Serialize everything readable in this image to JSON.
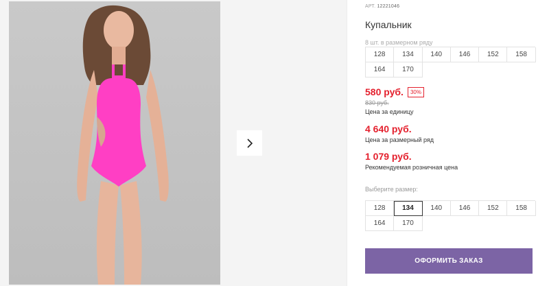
{
  "gallery": {
    "image_alt": "photo",
    "next_icon": "chevron-right-icon"
  },
  "product": {
    "article_label": "АРТ.",
    "article_code": "12221046",
    "title": "Купальник",
    "pack_note": "8 шт. в размерном ряду",
    "size_row": [
      "128",
      "134",
      "140",
      "146",
      "152",
      "158",
      "164",
      "170"
    ],
    "price": {
      "current": "580 руб.",
      "discount": "30%",
      "old": "830 руб.",
      "unit_label": "Цена за единицу",
      "row_price": "4 640 руб.",
      "row_label": "Цена за размерный ряд",
      "rrp": "1 079 руб.",
      "rrp_label": "Рекомендуемая розничная цена"
    },
    "choose_size_label": "Выберите размер:",
    "size_options": [
      "128",
      "134",
      "140",
      "146",
      "152",
      "158",
      "164",
      "170"
    ],
    "selected_size": "134",
    "order_button": "ОФОРМИТЬ ЗАКАЗ"
  },
  "colors": {
    "price_red": "#e4202d",
    "accent": "#7c64a5",
    "swimsuit": "#ff3fc4"
  }
}
